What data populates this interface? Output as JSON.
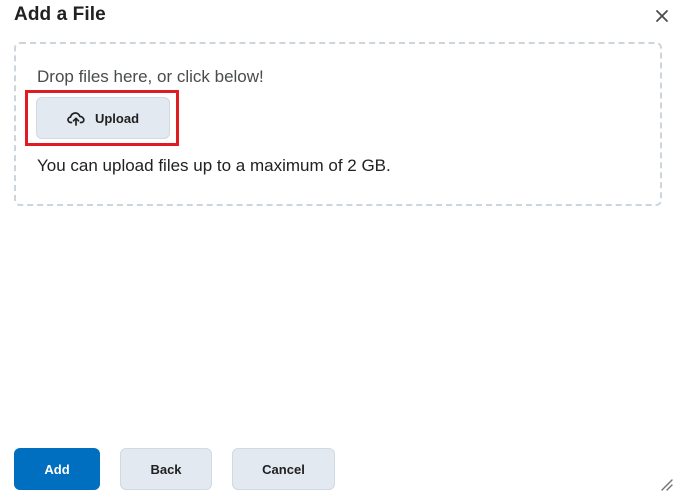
{
  "dialog": {
    "title": "Add a File"
  },
  "dropzone": {
    "instruction": "Drop files here, or click below!",
    "upload_label": "Upload",
    "upload_icon": "cloud-upload-icon",
    "max_size_text": "You can upload files up to a maximum of 2 GB."
  },
  "footer": {
    "add_label": "Add",
    "back_label": "Back",
    "cancel_label": "Cancel"
  },
  "icons": {
    "close": "close-icon",
    "resize": "resize-handle-icon"
  },
  "colors": {
    "primary": "#006fbf",
    "secondary_button": "#e3e9f1",
    "highlight": "#e11b22",
    "dropzone_border": "#cdd5dc"
  }
}
